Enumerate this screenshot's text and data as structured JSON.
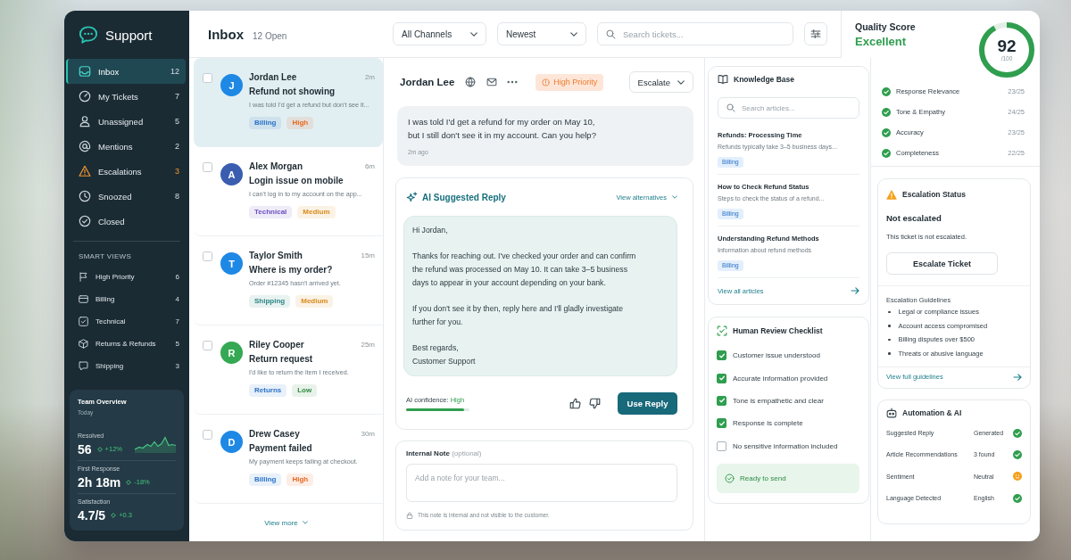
{
  "sidebar": {
    "title": "Support",
    "nav": [
      {
        "label": "Inbox",
        "count": "12",
        "selected": true,
        "alert": false
      },
      {
        "label": "My Tickets",
        "count": "7",
        "selected": false,
        "alert": false
      },
      {
        "label": "Unassigned",
        "count": "5",
        "selected": false,
        "alert": false
      },
      {
        "label": "Mentions",
        "count": "2",
        "selected": false,
        "alert": false
      },
      {
        "label": "Escalations",
        "count": "3",
        "selected": false,
        "alert": true
      },
      {
        "label": "Snoozed",
        "count": "8",
        "selected": false,
        "alert": false
      },
      {
        "label": "Closed",
        "selected": false,
        "alert": false
      }
    ],
    "smart_views_heading": "SMART VIEWS",
    "smart_views": [
      {
        "label": "High Priority",
        "count": "6",
        "selected": false
      },
      {
        "label": "Billing",
        "count": "4",
        "selected": false
      },
      {
        "label": "Technical",
        "count": "7",
        "selected": false
      },
      {
        "label": "Returns & Refunds",
        "count": "5",
        "selected": false
      },
      {
        "label": "Shipping",
        "count": "3",
        "selected": false
      }
    ],
    "team_overview": {
      "title": "Team Overview",
      "subtitle": "Today",
      "stats": [
        {
          "label": "Resolved",
          "value": "56",
          "change": "+12%"
        },
        {
          "label": "First Response",
          "value": "2h 18m",
          "change": "-18%"
        },
        {
          "label": "Satisfaction",
          "value": "4.7/5",
          "change": "+0.3"
        }
      ]
    }
  },
  "header": {
    "title": "Inbox",
    "open_count": "12 Open",
    "filters": [
      "All Channels",
      "Newest"
    ],
    "search_placeholder": "Search tickets..."
  },
  "quality": {
    "title": "Quality Score",
    "rating": "Excellent",
    "score": "92",
    "out_of": "/100",
    "level": 0.92,
    "criteria": [
      {
        "label": "Response Relevance",
        "score": "23/25"
      },
      {
        "label": "Tone & Empathy",
        "score": "24/25"
      },
      {
        "label": "Accuracy",
        "score": "23/25"
      },
      {
        "label": "Completeness",
        "score": "22/25"
      }
    ]
  },
  "tickets": [
    {
      "name": "Jordan Lee",
      "initial": "J",
      "color": "#1e88e5",
      "time": "2m",
      "subject": "Refund not showing",
      "preview": "I was told I'd get a refund but don't see it...",
      "tags": [
        {
          "label": "Billing",
          "color": "#2a72c8"
        },
        {
          "label": "High",
          "color": "#e8671f"
        }
      ],
      "selected": true,
      "checked": false
    },
    {
      "name": "Alex Morgan",
      "initial": "A",
      "color": "#3a5db0",
      "time": "6m",
      "subject": "Login issue on mobile",
      "preview": "I can't log in to my account on the app...",
      "tags": [
        {
          "label": "Technical",
          "color": "#6a4fc2"
        },
        {
          "label": "Medium",
          "color": "#d98b18"
        }
      ],
      "selected": false,
      "checked": false
    },
    {
      "name": "Taylor Smith",
      "initial": "T",
      "color": "#1e88e5",
      "time": "15m",
      "subject": "Where is my order?",
      "preview": "Order #12345 hasn't arrived yet.",
      "tags": [
        {
          "label": "Shipping",
          "color": "#2b8584"
        },
        {
          "label": "Medium",
          "color": "#d98b18"
        }
      ],
      "selected": false,
      "checked": false
    },
    {
      "name": "Riley Cooper",
      "initial": "R",
      "color": "#34a853",
      "time": "25m",
      "subject": "Return request",
      "preview": "I'd like to return the item I received.",
      "tags": [
        {
          "label": "Returns",
          "color": "#2a72c8"
        },
        {
          "label": "Low",
          "color": "#2e8b43"
        }
      ],
      "selected": false,
      "checked": false
    },
    {
      "name": "Drew Casey",
      "initial": "D",
      "color": "#1e88e5",
      "time": "30m",
      "subject": "Payment failed",
      "preview": "My payment keeps failing at checkout.",
      "tags": [
        {
          "label": "Billing",
          "color": "#2a72c8"
        },
        {
          "label": "High",
          "color": "#e8671f"
        }
      ],
      "selected": false,
      "checked": false
    }
  ],
  "view_more": "View more",
  "conversation": {
    "customer": "Jordan Lee",
    "priority": "High Priority",
    "escalate": "Escalate",
    "message": "I was told I'd get a refund for my order on May 10,\nbut I still don't see it in my account. Can you help?",
    "message_time": "2m ago"
  },
  "ai_reply": {
    "title": "AI Suggested Reply",
    "alternatives": "View alternatives",
    "paragraphs": [
      "Hi Jordan,",
      "Thanks for reaching out. I've checked your order and can confirm the refund was processed on May 10. It can take 3–5 business days to appear in your account depending on your bank.",
      "If you don't see it by then, reply here and I'll gladly investigate further for you.",
      "Best regards,\nCustomer Support"
    ],
    "confidence_label": "AI confidence:",
    "confidence_value": "High",
    "level": 0.92,
    "use_button": "Use Reply"
  },
  "internal_note": {
    "label": "Internal Note",
    "optional": "(optional)",
    "placeholder": "Add a note for your team...",
    "hint": "This note is internal and not visible to the customer."
  },
  "knowledge_base": {
    "title": "Knowledge Base",
    "search_placeholder": "Search articles...",
    "articles": [
      {
        "title": "Refunds: Processing Time",
        "summary": "Refunds typically take 3–5 business days...",
        "tag": "Billing"
      },
      {
        "title": "How to Check Refund Status",
        "summary": "Steps to check the status of a refund...",
        "tag": "Billing"
      },
      {
        "title": "Understanding Refund Methods",
        "summary": "Information about refund methods",
        "tag": "Billing"
      }
    ],
    "view_all": "View all articles"
  },
  "review_checklist": {
    "title": "Human Review Checklist",
    "items": [
      {
        "label": "Customer issue understood",
        "checked": true
      },
      {
        "label": "Accurate information provided",
        "checked": true
      },
      {
        "label": "Tone is empathetic and clear",
        "checked": true
      },
      {
        "label": "Response is complete",
        "checked": true
      },
      {
        "label": "No sensitive information included",
        "checked": false
      }
    ],
    "status": "Ready to send"
  },
  "escalation": {
    "title": "Escalation Status",
    "status": "Not escalated",
    "description": "This ticket is not escalated.",
    "button": "Escalate Ticket",
    "guidelines_title": "Escalation Guidelines",
    "guidelines": [
      "Legal or compliance issues",
      "Account access compromised",
      "Billing disputes over $500",
      "Threats or abusive language"
    ],
    "link": "View full guidelines"
  },
  "automation": {
    "title": "Automation & AI",
    "rows": [
      {
        "label": "Suggested Reply",
        "value": "Generated",
        "kind": "ok"
      },
      {
        "label": "Article Recommendations",
        "value": "3 found",
        "kind": "ok"
      },
      {
        "label": "Sentiment",
        "value": "Neutral",
        "kind": "neutral"
      },
      {
        "label": "Language Detected",
        "value": "English",
        "kind": "ok"
      }
    ]
  }
}
